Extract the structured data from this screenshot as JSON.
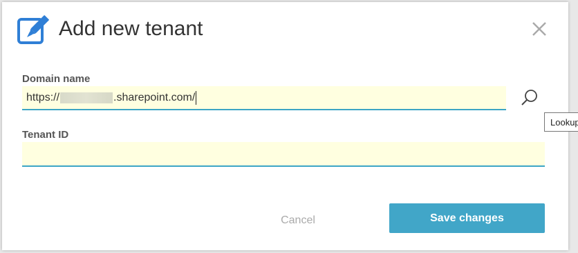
{
  "dialog": {
    "title": "Add new tenant",
    "header_icon": "edit-icon",
    "close_icon": "close-icon"
  },
  "domain_field": {
    "label": "Domain name",
    "value_prefix": "https://",
    "value_suffix": ".sharepoint.com/",
    "lookup_icon": "search-icon",
    "lookup_tooltip": "Lookup"
  },
  "tenant_field": {
    "label": "Tenant ID",
    "value": ""
  },
  "actions": {
    "cancel_label": "Cancel",
    "save_label": "Save changes"
  },
  "colors": {
    "accent": "#3ba5c5",
    "primary_button": "#41a6c8",
    "input_background": "#ffffe0",
    "icon_blue": "#2f7fd6"
  }
}
